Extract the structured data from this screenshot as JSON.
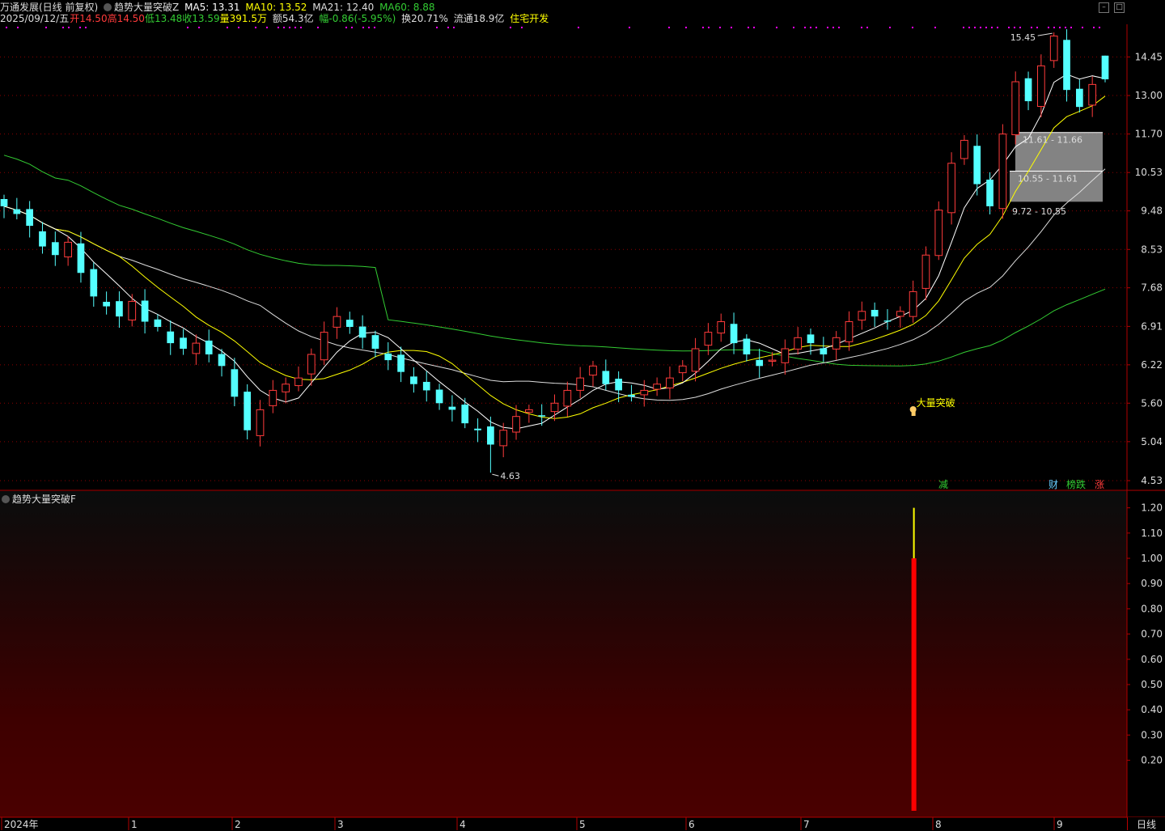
{
  "header": {
    "stock_name": "万通发展(日线 前复权)",
    "indicator_name": "趋势大量突破Z",
    "ma5": "MA5: 13.31",
    "ma10": "MA10: 13.52",
    "ma21": "MA21: 12.40",
    "ma60": "MA60: 8.88",
    "date": "2025/09/12/五",
    "open": "开14.50",
    "high": "高14.50",
    "low": "低13.48",
    "close": "收13.59",
    "volume": "量391.5万",
    "amount": "额54.3亿",
    "change": "幅-0.86(-5.95%)",
    "turnover": "换20.71%",
    "float_cap": "流通18.9亿",
    "sector": "住宅开发"
  },
  "colors": {
    "up": "#ff3b3b",
    "down": "#54ffff",
    "ma5": "#ffffff",
    "ma10": "#ffff00",
    "ma21": "#ffffff",
    "ma60": "#33cc33",
    "grid": "#8b0000",
    "axis": "#b00000",
    "magenta": "#ff00ff",
    "zone": "#9a9a9a",
    "bar_red": "#ff0000",
    "bar_yellow": "#ffff00"
  },
  "main_axis": {
    "ticks": [
      "14.45",
      "13.00",
      "11.70",
      "10.53",
      "9.48",
      "8.53",
      "7.68",
      "6.91",
      "6.22",
      "5.60",
      "5.04",
      "4.53"
    ]
  },
  "sub_axis": {
    "ticks": [
      "1.20",
      "1.10",
      "1.00",
      "0.90",
      "0.80",
      "0.70",
      "0.60",
      "0.50",
      "0.40",
      "0.30",
      "0.20"
    ]
  },
  "annotations": {
    "high_label": "15.45",
    "low_label": "4.63",
    "breakout_label": "大量突破",
    "zone1_label": "11.61 - 11.66",
    "zone2_label": "10.55 - 11.61",
    "zone3_label": "9.72 - 10.55",
    "markers": [
      {
        "text": "减",
        "color": "#33cc33"
      },
      {
        "text": "财",
        "color": "#66ccff"
      },
      {
        "text": "榜跌",
        "color": "#33cc33"
      },
      {
        "text": "涨",
        "color": "#ff3b3b"
      }
    ]
  },
  "x_axis": {
    "labels": [
      "2024年",
      "1",
      "2",
      "3",
      "4",
      "5",
      "6",
      "7",
      "8",
      "9"
    ]
  },
  "sub_panel": {
    "title": "趋势大量突破F"
  },
  "period_label": "日线",
  "window_controls": {
    "minimize": "–",
    "maximize": "□"
  },
  "chart_data": {
    "type": "candlestick",
    "title": "万通发展(日线 前复权)",
    "scale": "log",
    "ylim": [
      4.5,
      15.8
    ],
    "high": 15.45,
    "low": 4.63,
    "x_axis_labels": [
      "2024年",
      "1",
      "2",
      "3",
      "4",
      "5",
      "6",
      "7",
      "8",
      "9"
    ],
    "last_bar": {
      "open": 14.5,
      "high": 14.5,
      "low": 13.48,
      "close": 13.59
    },
    "moving_averages": {
      "MA5": 13.31,
      "MA10": 13.52,
      "MA21": 12.4,
      "MA60": 8.88
    },
    "close_series": [
      9.6,
      9.4,
      9.1,
      8.6,
      8.4,
      8.7,
      8.0,
      7.5,
      7.3,
      7.1,
      7.4,
      7.0,
      6.9,
      6.6,
      6.5,
      6.6,
      6.4,
      6.2,
      5.7,
      5.2,
      5.5,
      5.8,
      5.9,
      6.0,
      6.4,
      6.8,
      7.1,
      6.9,
      6.7,
      6.5,
      6.3,
      6.1,
      5.9,
      5.8,
      5.6,
      5.5,
      5.3,
      5.2,
      5.0,
      5.2,
      5.4,
      5.5,
      5.4,
      5.6,
      5.8,
      6.0,
      6.2,
      5.9,
      5.8,
      5.7,
      5.8,
      5.9,
      6.0,
      6.2,
      6.5,
      6.8,
      7.0,
      6.6,
      6.4,
      6.2,
      6.3,
      6.5,
      6.7,
      6.6,
      6.4,
      6.7,
      7.0,
      7.2,
      7.1,
      7.0,
      7.2,
      7.6,
      8.4,
      9.5,
      10.8,
      11.5,
      10.2,
      9.6,
      11.7,
      13.5,
      12.8,
      14.1,
      15.3,
      13.2,
      12.6,
      13.4,
      13.59
    ],
    "volume_signal": {
      "value": 1.2,
      "filled_to": 1.0,
      "ylim": [
        0,
        1.25
      ],
      "ticks": [
        1.2,
        1.1,
        1.0,
        0.9,
        0.8,
        0.7,
        0.6,
        0.5,
        0.4,
        0.3,
        0.2
      ]
    },
    "zones": [
      {
        "low": 11.61,
        "high": 11.66
      },
      {
        "low": 10.55,
        "high": 11.61
      },
      {
        "low": 9.72,
        "high": 10.55
      }
    ]
  }
}
